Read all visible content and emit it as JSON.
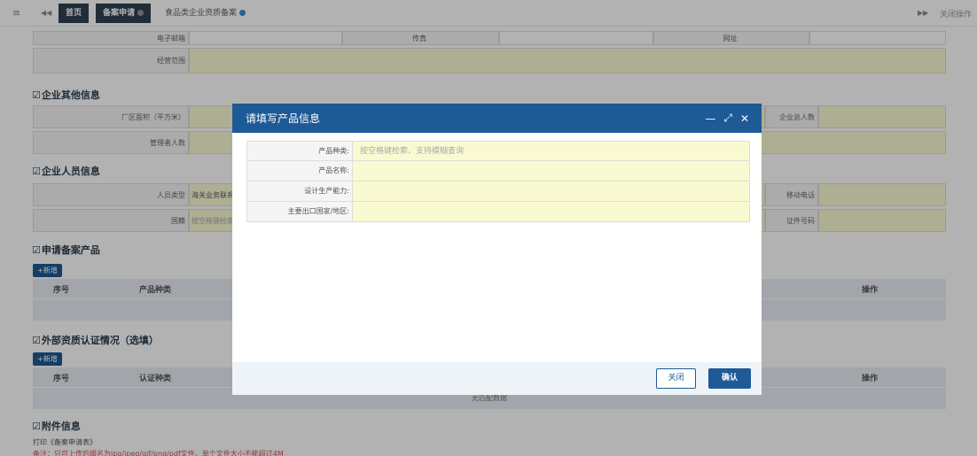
{
  "topbar": {
    "menu_icon": "≡",
    "prev_icon": "◀◀",
    "tab_home": "首页",
    "tab_filing": "备案申请",
    "tab_current": "食品类企业资质备案",
    "next_icon": "▶▶",
    "close_ops": "关闭操作"
  },
  "info": {
    "email": "电子邮箱",
    "fax": "传真",
    "website": "网址",
    "scope": "经营范围"
  },
  "other": {
    "title": "企业其他信息",
    "area": "厂区面积（平方米）",
    "total_staff": "企业总人数",
    "managers": "管理者人数"
  },
  "staff": {
    "title": "企业人员信息",
    "person_type": "人员类型",
    "person_type_value": "海关业务联系",
    "mobile": "移动电话",
    "nationality": "国籍",
    "nationality_placeholder": "按空格键检索",
    "id_no": "证件号码"
  },
  "products": {
    "title": "申请备案产品",
    "add": "+新增",
    "col_no": "序号",
    "col_type": "产品种类",
    "col_ops": "操作"
  },
  "certs": {
    "title": "外部资质认证情况（选填）",
    "add": "+新增",
    "col_no": "序号",
    "col_type": "认证种类",
    "col_ops": "操作",
    "empty": "无匹配数据"
  },
  "attach": {
    "title": "附件信息",
    "print": "打印《备案申请表》",
    "note": "备注：只可上传后缀名为jpg/jpeg/gif/png/pdf文件，单个文件大小不能超过4M"
  },
  "modal": {
    "title": "请填写产品信息",
    "min": "—",
    "max": "⤢",
    "close": "✕",
    "fields": [
      {
        "label": "产品种类:",
        "value": "按空格键检索、支持模糊查询"
      },
      {
        "label": "产品名称:",
        "value": ""
      },
      {
        "label": "设计生产能力:",
        "value": ""
      },
      {
        "label": "主要出口国家/地区:",
        "value": ""
      }
    ],
    "btn_close": "关闭",
    "btn_ok": "确认"
  }
}
